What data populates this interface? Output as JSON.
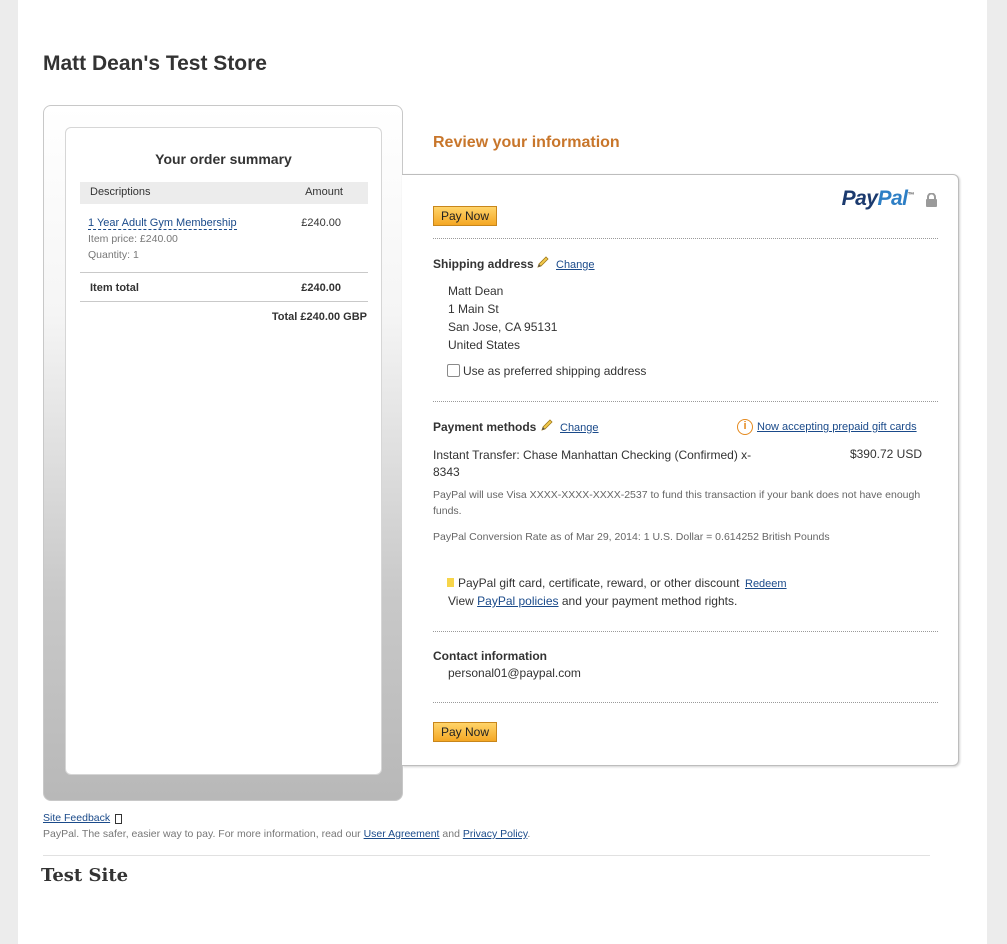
{
  "store": {
    "title": "Matt Dean's Test Store"
  },
  "summary": {
    "title": "Your order summary",
    "col_desc": "Descriptions",
    "col_amount": "Amount",
    "item": {
      "name": "1 Year Adult Gym Membership",
      "amount": "£240.00",
      "price": "Item price: £240.00",
      "quantity": "Quantity: 1"
    },
    "item_total_label": "Item total",
    "item_total_value": "£240.00",
    "grand_total": "Total £240.00 GBP"
  },
  "review": {
    "title": "Review your information",
    "logo_pay": "Pay",
    "logo_pal": "Pal",
    "logo_tm": "™",
    "pay_now": "Pay Now",
    "shipping": {
      "heading": "Shipping address",
      "change": "Change",
      "name": "Matt Dean",
      "street": "1 Main St",
      "city": "San Jose, CA 95131",
      "country": "United States",
      "preferred_label": "Use as preferred shipping address"
    },
    "payment": {
      "heading": "Payment methods",
      "change": "Change",
      "gift_cards_link": "Now accepting prepaid gift cards",
      "method": "Instant Transfer: Chase Manhattan Checking (Confirmed) x-8343",
      "amount": "$390.72 USD",
      "backup_note": "PayPal will use Visa XXXX-XXXX-XXXX-2537 to fund this transaction if your bank does not have enough funds.",
      "conversion": "PayPal Conversion Rate as of Mar 29, 2014: 1 U.S. Dollar = 0.614252 British Pounds",
      "gift_text": "PayPal gift card, certificate, reward, or other discount",
      "redeem": "Redeem",
      "policy_prefix": "View ",
      "policy_link": "PayPal policies",
      "policy_suffix": " and your payment method rights."
    },
    "contact": {
      "heading": "Contact information",
      "email": "personal01@paypal.com"
    }
  },
  "footer": {
    "feedback": "Site Feedback",
    "text_prefix": "PayPal. The safer, easier way to pay. For more information, read our ",
    "user_agreement": "User Agreement",
    "and": " and ",
    "privacy": "Privacy Policy",
    "period": ".",
    "site_name": "Test Site"
  },
  "colors": {
    "review_title": "#c8762b",
    "link": "#1a4a8a",
    "button": "#f4a724",
    "paypal_dark": "#1b3a6e",
    "paypal_light": "#2e7fc5"
  }
}
